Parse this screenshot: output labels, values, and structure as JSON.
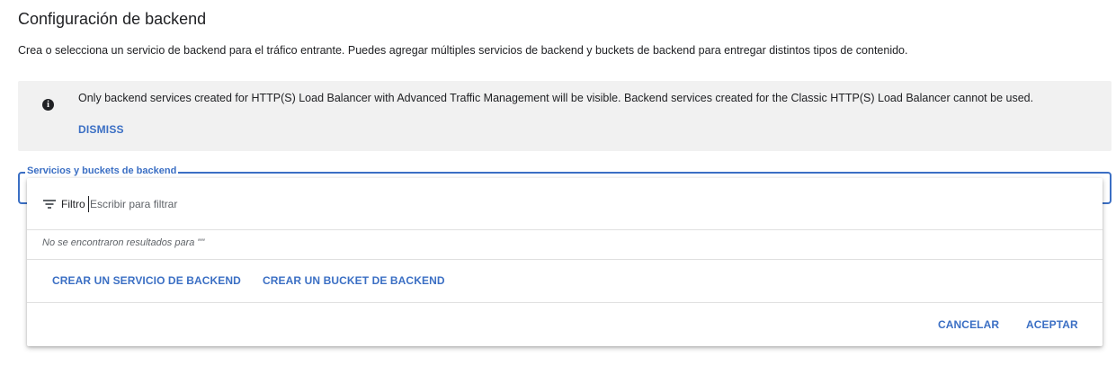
{
  "header": {
    "title": "Configuración de backend",
    "description": "Crea o selecciona un servicio de backend para el tráfico entrante. Puedes agregar múltiples servicios de backend y buckets de backend para entregar distintos tipos de contenido."
  },
  "info_banner": {
    "icon": "info-icon",
    "message": "Only backend services created for HTTP(S) Load Balancer with Advanced Traffic Management will be visible. Backend services created for the Classic HTTP(S) Load Balancer cannot be used.",
    "dismiss_label": "DISMISS"
  },
  "backend_select": {
    "label": "Servicios y buckets de backend",
    "accent_color": "#3b6fc4"
  },
  "dropdown": {
    "filter_icon": "filter-icon",
    "filter_label": "Filtro",
    "filter_placeholder": "Escribir para filtrar",
    "filter_value": "",
    "empty_message": "No se encontraron resultados para \"\"",
    "create_service_label": "CREAR UN SERVICIO DE BACKEND",
    "create_bucket_label": "CREAR UN BUCKET DE BACKEND",
    "cancel_label": "CANCELAR",
    "accept_label": "ACEPTAR"
  }
}
